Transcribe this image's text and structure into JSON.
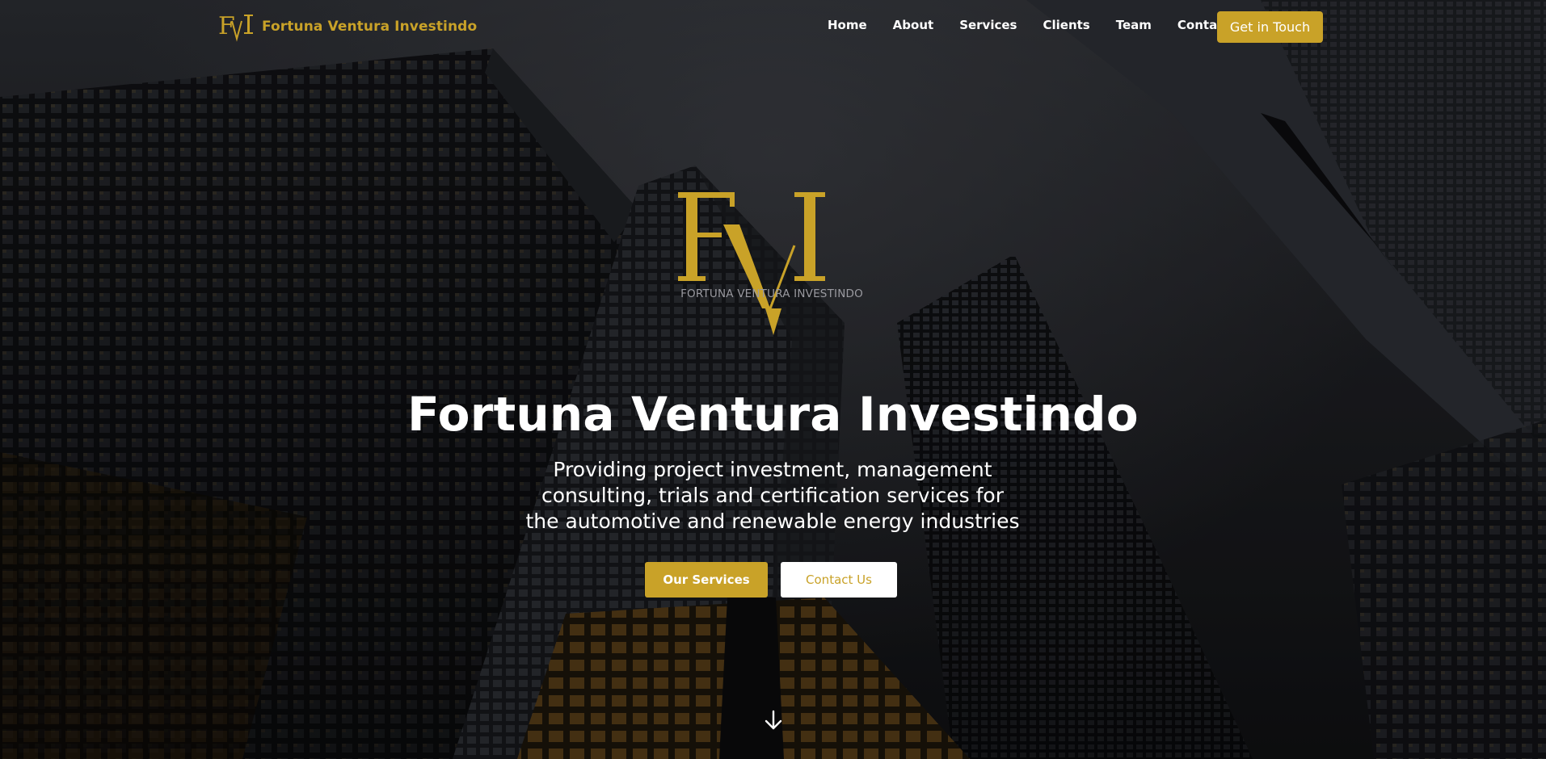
{
  "brand": {
    "name": "Fortuna Ventura Investindo",
    "logo_icon": "fvi-monogram-logo",
    "color": "#c9a228"
  },
  "nav": {
    "items": [
      {
        "label": "Home"
      },
      {
        "label": "About"
      },
      {
        "label": "Services"
      },
      {
        "label": "Clients"
      },
      {
        "label": "Team"
      },
      {
        "label": "Contact"
      }
    ],
    "cta_label": "Get in Touch"
  },
  "hero": {
    "logo_monogram": "FVI",
    "logo_caption": "FORTUNA VENTURA INVESTINDO",
    "title": "Fortuna Ventura Investindo",
    "subtitle": "Providing project investment, management consulting, trials and certification services for the automotive and renewable energy industries",
    "primary_button": "Our Services",
    "secondary_button": "Contact Us",
    "scroll_icon": "arrow-down-icon"
  },
  "colors": {
    "accent": "#c9a228",
    "text": "#ffffff",
    "background": "#1d1e22"
  }
}
